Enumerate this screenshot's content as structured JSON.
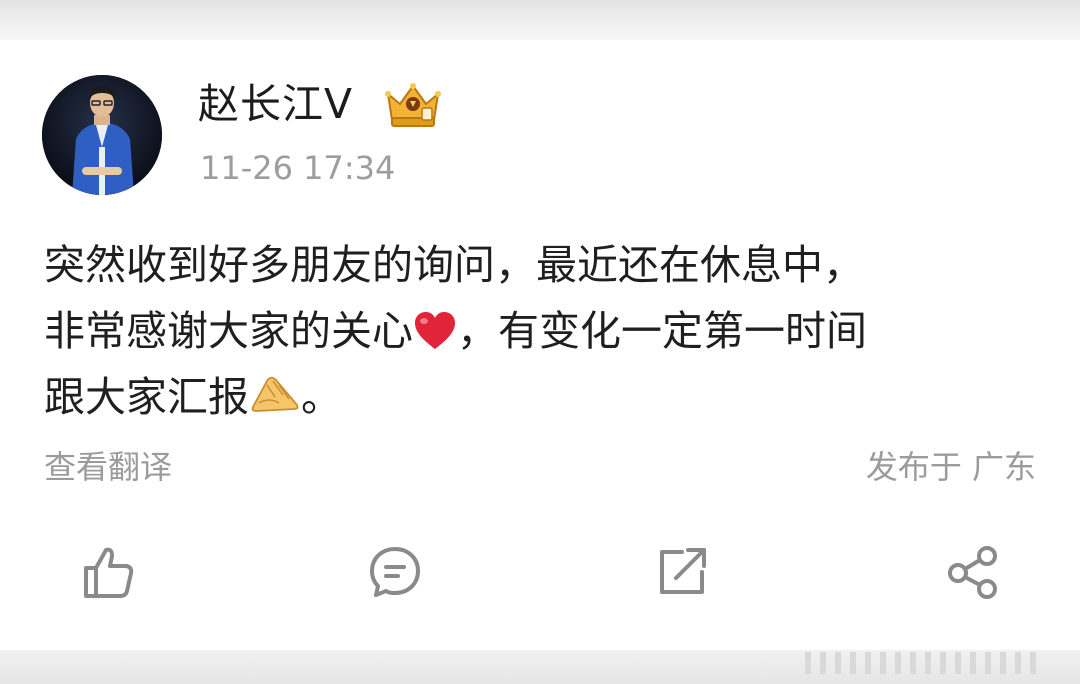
{
  "post": {
    "author": {
      "name": "赵长江V",
      "avatar_icon": "avatar-photo",
      "badge_icon": "crown-badge-icon"
    },
    "timestamp": "11-26 17:34",
    "content": {
      "line1": "突然收到好多朋友的询问，最近还在休息中，",
      "line2_a": "非常感谢大家的关心",
      "line2_emoji": "red-heart-emoji",
      "line2_b": "，有变化一定第一时间",
      "line3_a": "跟大家汇报",
      "line3_emoji": "handshake-emoji",
      "line3_b": "。"
    },
    "translate_label": "查看翻译",
    "location_label": "发布于 广东"
  },
  "actions": [
    {
      "name": "like",
      "icon": "thumbs-up-icon"
    },
    {
      "name": "comment",
      "icon": "comment-icon"
    },
    {
      "name": "repost",
      "icon": "repost-icon"
    },
    {
      "name": "share",
      "icon": "share-icon"
    }
  ],
  "colors": {
    "primary_text": "#1f1f1f",
    "secondary_text": "#9b9b9b",
    "icon_gray": "#8a8a8a",
    "heart_red": "#e0243a",
    "badge_gold": "#f2b233"
  }
}
